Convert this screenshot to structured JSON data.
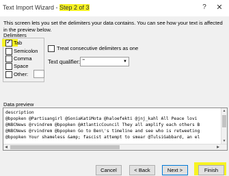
{
  "window": {
    "title_prefix": "Text Import Wizard - ",
    "title_step": "Step 2 of 3",
    "help_icon": "?",
    "close_icon": "✕"
  },
  "intro_text": "This screen lets you set the delimiters your data contains.  You can see how your text is affected in the preview below.",
  "delimiters": {
    "group_label": "Delimiters",
    "items": [
      {
        "label": "Tab",
        "checked": true
      },
      {
        "label": "Semicolon",
        "checked": false
      },
      {
        "label": "Comma",
        "checked": false
      },
      {
        "label": "Space",
        "checked": false
      },
      {
        "label": "Other:",
        "checked": false
      }
    ]
  },
  "consecutive": {
    "label": "Treat consecutive delimiters as one",
    "checked": false
  },
  "qualifier": {
    "label": "Text qualifier:",
    "value": "\""
  },
  "preview": {
    "label": "Data preview",
    "lines": [
      "description",
      "@bpopken @Partisangirl @SoniaKatiMota @haloefekti @jnj_kahl  All Peace lovi",
      "@NBCNews @rvindrem @bpopken @AtlanticCouncil They all amplify each others B",
      "@NBCNews @rvindrem @bpopken Go to Ben\\'s timeline and see who is retweeting",
      "@bpopken Your shameless &amp; fascist attempt to smear @TulsiGabbard, an el"
    ]
  },
  "buttons": {
    "cancel": "Cancel",
    "back": "< Back",
    "next": "Next >",
    "finish": "Finish"
  },
  "highlight_color": "#f7f322"
}
